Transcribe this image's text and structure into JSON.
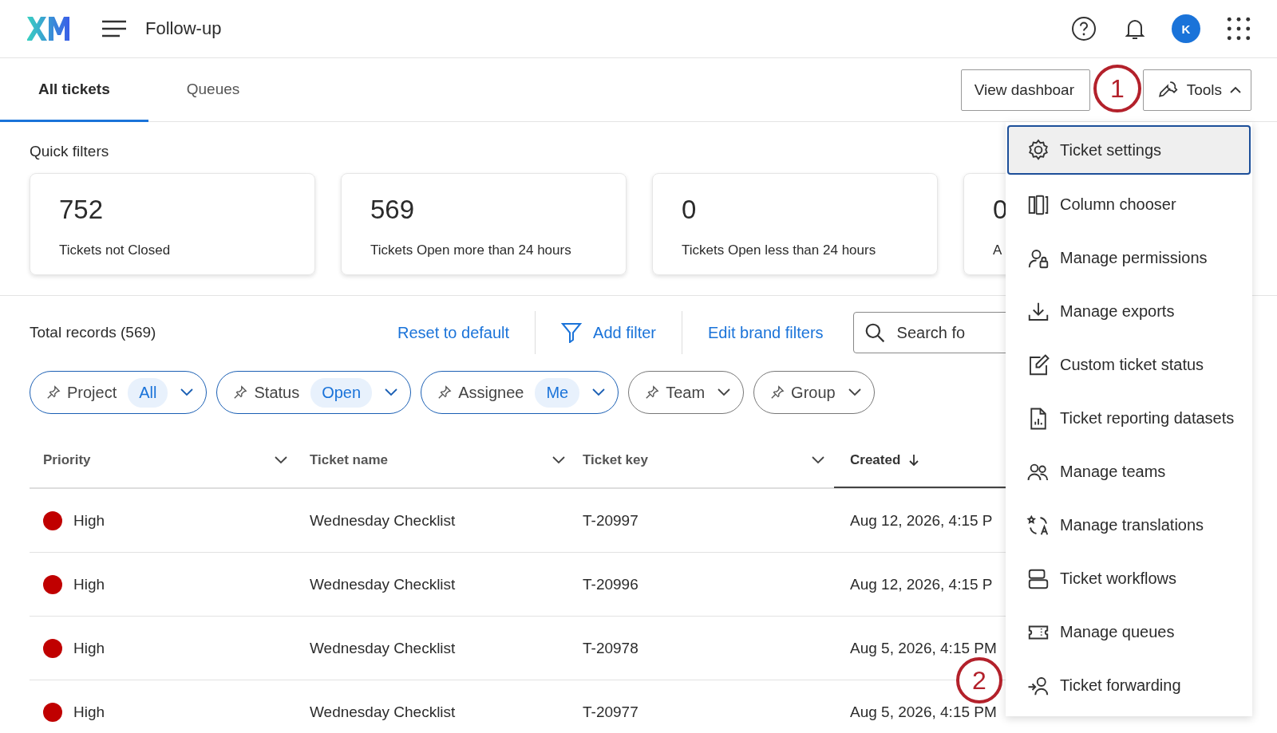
{
  "header": {
    "title": "Follow-up",
    "avatar": "K"
  },
  "tabs": [
    {
      "label": "All tickets",
      "selected": true
    },
    {
      "label": "Queues",
      "selected": false
    }
  ],
  "actions": {
    "dashboard": "View dashboar",
    "tools": "Tools",
    "tools_expanded": true
  },
  "quick_filters": {
    "title": "Quick filters",
    "cards": [
      {
        "value": "752",
        "label": "Tickets not Closed"
      },
      {
        "value": "569",
        "label": "Tickets Open more than 24 hours"
      },
      {
        "value": "0",
        "label": "Tickets Open less than 24 hours"
      },
      {
        "value": "0",
        "label": "A"
      }
    ]
  },
  "toolbar": {
    "total": "Total records (569)",
    "reset": "Reset to default",
    "add_filter": "Add filter",
    "brand": "Edit brand filters",
    "search_placeholder": "Search fo"
  },
  "filters": [
    {
      "label": "Project",
      "value": "All",
      "active": true
    },
    {
      "label": "Status",
      "value": "Open",
      "active": true
    },
    {
      "label": "Assignee",
      "value": "Me",
      "active": true
    },
    {
      "label": "Team",
      "active": false
    },
    {
      "label": "Group",
      "active": false
    }
  ],
  "table": {
    "columns": [
      {
        "label": "Priority",
        "sorted": false
      },
      {
        "label": "Ticket name",
        "sorted": false
      },
      {
        "label": "Ticket key",
        "sorted": false
      },
      {
        "label": "Created",
        "sorted": true
      }
    ],
    "rows": [
      {
        "priority": "High",
        "color": "#c00000",
        "name": "Wednesday Checklist",
        "key": "T-20997",
        "created": "Aug 12, 2026, 4:15 P"
      },
      {
        "priority": "High",
        "color": "#c00000",
        "name": "Wednesday Checklist",
        "key": "T-20996",
        "created": "Aug 12, 2026, 4:15 P"
      },
      {
        "priority": "High",
        "color": "#c00000",
        "name": "Wednesday Checklist",
        "key": "T-20978",
        "created": "Aug 5, 2026, 4:15 PM"
      },
      {
        "priority": "High",
        "color": "#c00000",
        "name": "Wednesday Checklist",
        "key": "T-20977",
        "created": "Aug 5, 2026, 4:15 PM"
      }
    ]
  },
  "tools_menu": [
    {
      "label": "Ticket settings",
      "selected": true
    },
    {
      "label": "Column chooser",
      "selected": false
    },
    {
      "label": "Manage permissions",
      "selected": false
    },
    {
      "label": "Manage exports",
      "selected": false
    },
    {
      "label": "Custom ticket status",
      "selected": false
    },
    {
      "label": "Ticket reporting datasets",
      "selected": false
    },
    {
      "label": "Manage teams",
      "selected": false
    },
    {
      "label": "Manage translations",
      "selected": false
    },
    {
      "label": "Ticket workflows",
      "selected": false
    },
    {
      "label": "Manage queues",
      "selected": false
    },
    {
      "label": "Ticket forwarding",
      "selected": false
    }
  ],
  "callouts": [
    "1",
    "2"
  ]
}
